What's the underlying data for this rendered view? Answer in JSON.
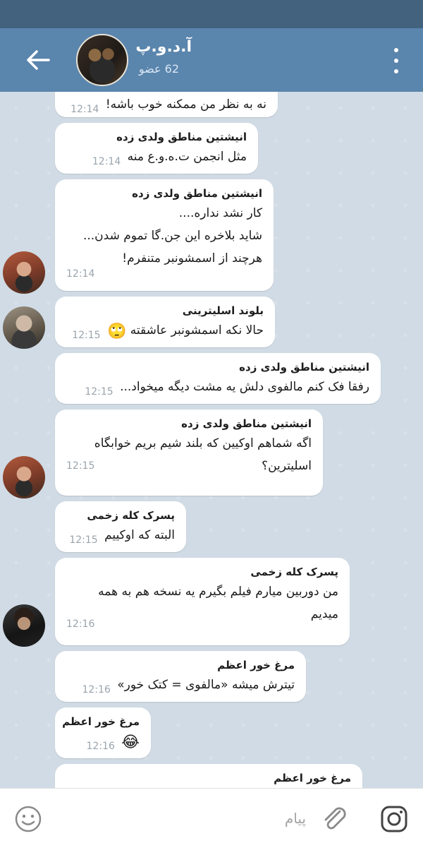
{
  "colors": {
    "header": "#5a85ad",
    "statusbar": "#43627e",
    "chat_bg": "#d0dbe5",
    "bubble": "#ffffff",
    "timestamp": "#9aa4ad"
  },
  "header": {
    "title": "آ.د.و.پ",
    "subtitle": "62 عضو",
    "back_icon": "arrow-left-icon",
    "menu_icon": "more-vertical-icon"
  },
  "messages": [
    {
      "sender": "",
      "lines": [
        "نه به نظر من ممکنه خوب باشه!"
      ],
      "time": "12:14"
    },
    {
      "sender": "انیشتین مناطق ولدی زده",
      "lines": [
        "مثل انجمن ت.ه.و.ع منه"
      ],
      "time": "12:14"
    },
    {
      "sender": "انیشتین مناطق ولدی زده",
      "lines": [
        "کار نشد نداره....",
        "شاید بلاخره این جن.گا تموم شدن...",
        "هرچند از اسمشونبر متنفرم!"
      ],
      "time": "12:14"
    },
    {
      "sender": "بلوند اسلیترینی",
      "lines": [
        "حالا نکه اسمشونبر عاشقته"
      ],
      "emoji": "🙄",
      "time": "12:15"
    },
    {
      "sender": "انیشتین مناطق ولدی زده",
      "lines": [
        "رفقا فک کنم مالفوی دلش یه مشت دیگه میخواد..."
      ],
      "time": "12:15"
    },
    {
      "sender": "انیشتین مناطق ولدی زده",
      "lines": [
        "اگه شماهم اوکیین که بلند شیم بریم خوابگاه",
        "اسلیترین؟"
      ],
      "time": "12:15"
    },
    {
      "sender": "پسرک کله زخمی",
      "lines": [
        "البته که اوکییم"
      ],
      "time": "12:15"
    },
    {
      "sender": "پسرک کله زخمی",
      "lines": [
        "من دوربین میارم فیلم بگیرم یه نسخه هم به همه",
        "میدیم"
      ],
      "time": "12:16"
    },
    {
      "sender": "مرغ خور اعظم",
      "lines": [
        "تیترش میشه «مالفوی = کتک خور»"
      ],
      "time": "12:16"
    },
    {
      "sender": "مرغ خور اعظم",
      "lines": [
        ""
      ],
      "emoji": "😂",
      "time": "12:16"
    },
    {
      "sender": "مرغ خور اعظم",
      "lines": [],
      "time": ""
    }
  ],
  "composer": {
    "placeholder": "پیام",
    "emoji_icon": "smile-icon",
    "attach_icon": "paperclip-icon",
    "camera_icon": "instagram-camera-icon"
  }
}
